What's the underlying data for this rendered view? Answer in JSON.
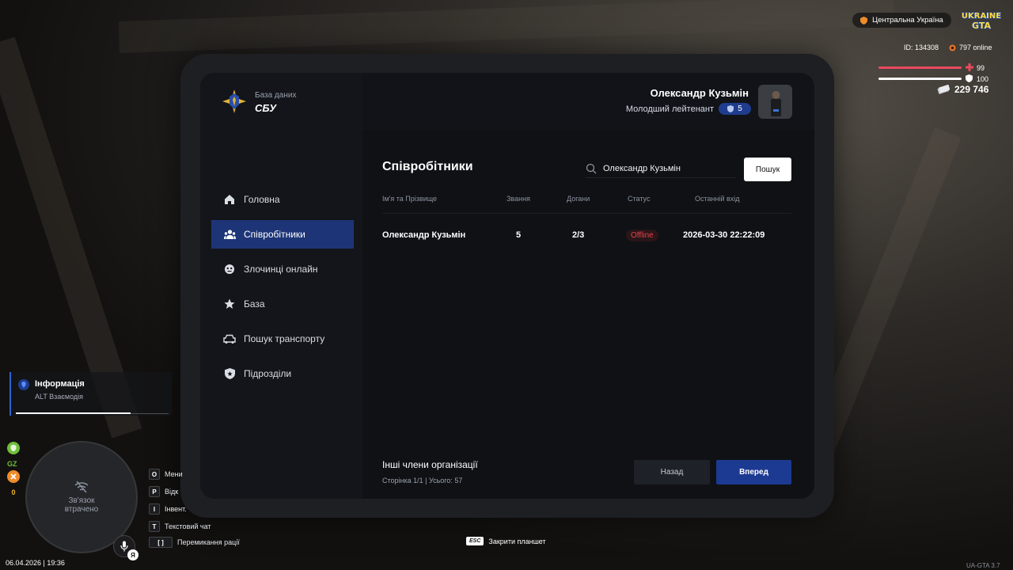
{
  "header": {
    "db_label": "База даних",
    "org_name": "СБУ",
    "user_name": "Олександр Кузьмін",
    "user_rank": "Молодший лейтенант",
    "rank_level": "5"
  },
  "sidebar": {
    "items": [
      {
        "label": "Головна",
        "icon": "home-icon"
      },
      {
        "label": "Співробітники",
        "icon": "users-icon",
        "active": true
      },
      {
        "label": "Злочинці онлайн",
        "icon": "mask-icon"
      },
      {
        "label": "База",
        "icon": "star-icon"
      },
      {
        "label": "Пошук транспорту",
        "icon": "car-icon"
      },
      {
        "label": "Підрозділи",
        "icon": "shield-icon"
      }
    ]
  },
  "main": {
    "title": "Співробітники",
    "search_value": "Олександр Кузьмін",
    "search_button": "Пошук",
    "columns": [
      "Ім'я та Прізвище",
      "Звання",
      "Догани",
      "Статус",
      "Останній вхід"
    ],
    "rows": [
      {
        "name": "Олександр Кузьмін",
        "rank": "5",
        "reprimands": "2/3",
        "status": "Offline",
        "last_login": "2026-03-30 22:22:09"
      }
    ],
    "footer_title": "Інші члени організації",
    "footer_sub": "Сторінка 1/1 | Усього: 57",
    "back_button": "Назад",
    "next_button": "Вперед"
  },
  "hud": {
    "region": "Центральна Україна",
    "logo_text": "UKRAINE GTA",
    "player_id": "ID: 134308",
    "online": "797 online",
    "health": "99",
    "armor": "100",
    "money": "229 746",
    "info_title": "Інформація",
    "info_sub": "ALT Взаємодія",
    "side_label_gz": "GZ",
    "side_count": "0",
    "map_message_line1": "Зв'язок",
    "map_message_line2": "втрачено",
    "voice_key": "Я",
    "keys": [
      {
        "key": "O",
        "label": "Мени"
      },
      {
        "key": "P",
        "label": "Відк"
      },
      {
        "key": "I",
        "label": "Інвент."
      },
      {
        "key": "T",
        "label": "Текстовий чат"
      },
      {
        "key": "[ ]",
        "label": "Перемикання рації"
      }
    ],
    "datetime": "06.04.2026 | 19:36",
    "esc_key": "ESC",
    "esc_label": "Закрити планшет",
    "version": "UA-GTA 3.7"
  },
  "colors": {
    "accent": "#1d3a92",
    "status_offline": "#e2434b",
    "health": "#e84a5f",
    "armor": "#ffffff"
  }
}
